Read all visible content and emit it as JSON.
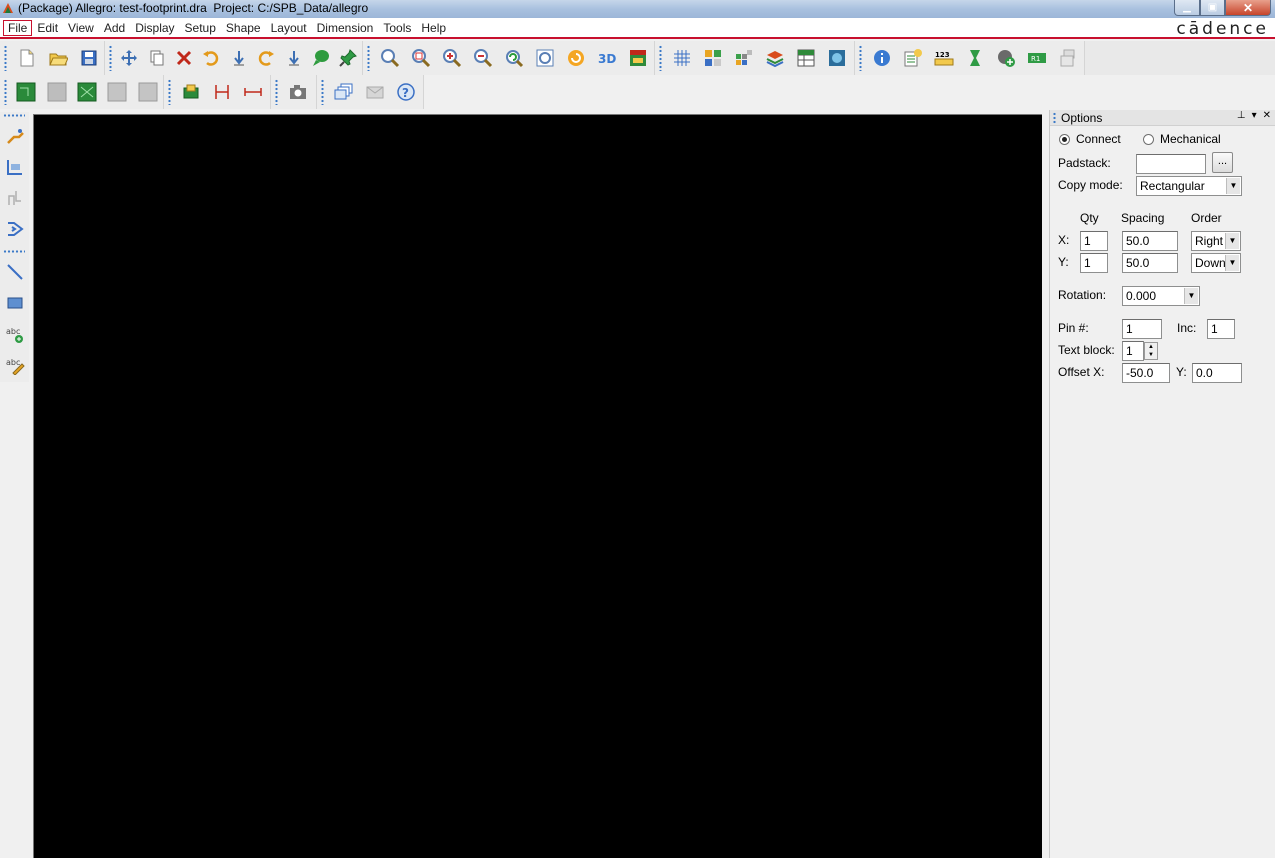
{
  "window": {
    "title": "(Package) Allegro: test-footprint.dra  Project: C:/SPB_Data/allegro",
    "brand": "cādence"
  },
  "menu": [
    {
      "label": "File"
    },
    {
      "label": "Edit"
    },
    {
      "label": "View"
    },
    {
      "label": "Add"
    },
    {
      "label": "Display"
    },
    {
      "label": "Setup"
    },
    {
      "label": "Shape"
    },
    {
      "label": "Layout"
    },
    {
      "label": "Dimension"
    },
    {
      "label": "Tools"
    },
    {
      "label": "Help"
    }
  ],
  "options": {
    "title": "Options",
    "connect_label": "Connect",
    "mechanical_label": "Mechanical",
    "padstack_label": "Padstack:",
    "padstack_value": "",
    "browse_label": "...",
    "copy_mode_label": "Copy mode:",
    "copy_mode_value": "Rectangular",
    "qty_header": "Qty",
    "spacing_header": "Spacing",
    "order_header": "Order",
    "x_label": "X:",
    "y_label": "Y:",
    "x_qty": "1",
    "y_qty": "1",
    "x_spacing": "50.0",
    "y_spacing": "50.0",
    "x_order": "Right",
    "y_order": "Down",
    "rotation_label": "Rotation:",
    "rotation_value": "0.000",
    "pin_label": "Pin #:",
    "pin_value": "1",
    "inc_label": "Inc:",
    "inc_value": "1",
    "text_block_label": "Text block:",
    "text_block_value": "1",
    "offset_x_label": "Offset X:",
    "offset_x_value": "-50.0",
    "offset_y_label": "Y:",
    "offset_y_value": "0.0"
  }
}
